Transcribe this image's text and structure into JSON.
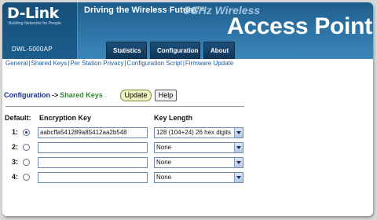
{
  "header": {
    "logo": "D-Link",
    "logo_tagline": "Building Networks for People",
    "model": "DWL-5000AP",
    "slogan": "Driving the Wireless Future™",
    "subtitle": "5GHz Wireless",
    "title": "Access Point",
    "tabs": [
      {
        "label": "Statistics"
      },
      {
        "label": "Configuration"
      },
      {
        "label": "About"
      }
    ]
  },
  "sublinks": [
    {
      "label": "General"
    },
    {
      "label": "Shared Keys"
    },
    {
      "label": "Per Station Privacy"
    },
    {
      "label": "Configuration Script"
    },
    {
      "label": "Firmware Update"
    }
  ],
  "breadcrumb": {
    "section": "Configuration",
    "arrow": "->",
    "page": "Shared Keys"
  },
  "buttons": {
    "update": "Update",
    "help": "Help"
  },
  "table": {
    "default_label": "Default:",
    "encryption_key_label": "Encryption Key",
    "key_length_label": "Key Length",
    "rows": [
      {
        "num": "1:",
        "selected": true,
        "key": "aabcffa541289a85412aa2b548",
        "length": "128 (104+24) 26 hex digits"
      },
      {
        "num": "2:",
        "selected": false,
        "key": "",
        "length": "None"
      },
      {
        "num": "3:",
        "selected": false,
        "key": "",
        "length": "None"
      },
      {
        "num": "4:",
        "selected": false,
        "key": "",
        "length": "None"
      }
    ]
  },
  "colors": {
    "header_blue": "#2f76a8",
    "tab_navy": "#0f3556",
    "link_blue": "#1e5b9c",
    "breadcrumb_green": "#2d8a2d"
  }
}
